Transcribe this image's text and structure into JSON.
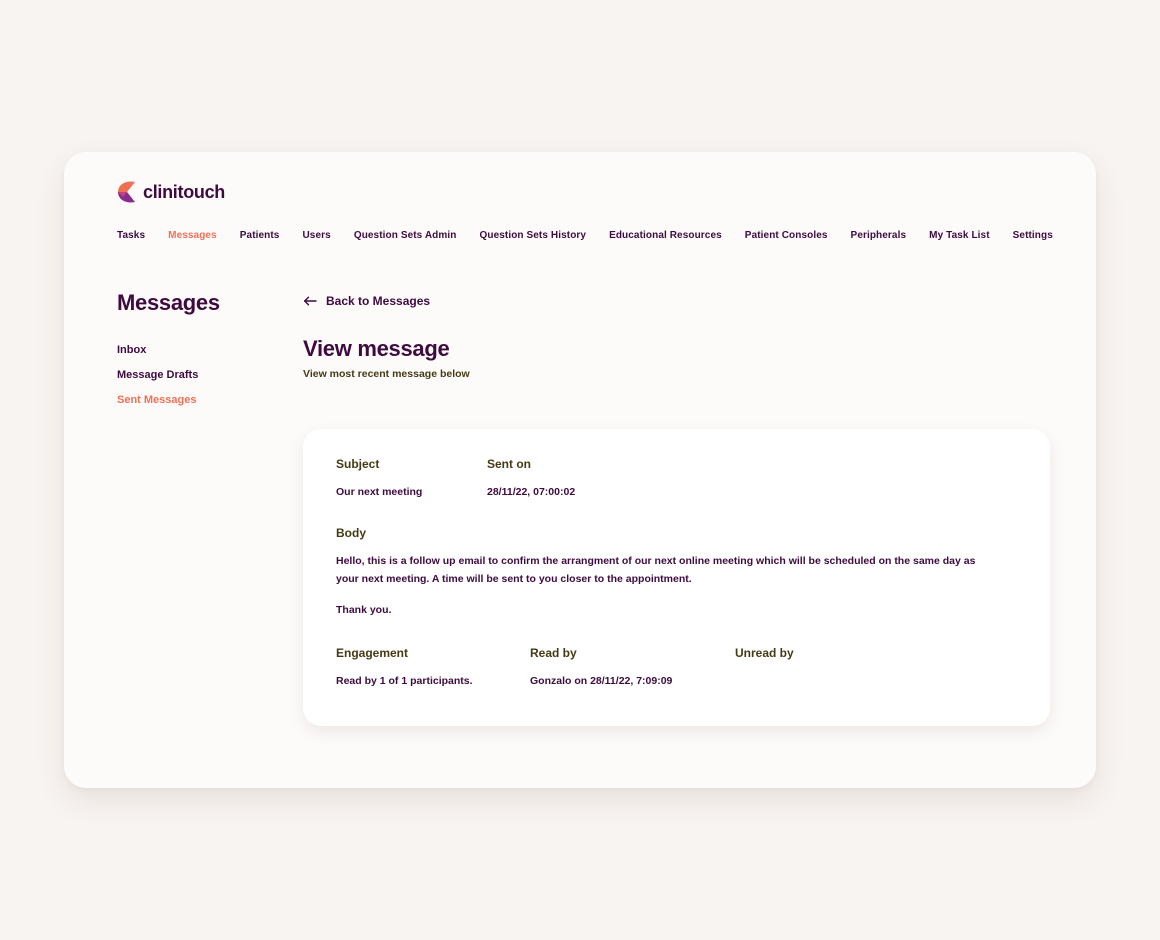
{
  "brand": {
    "name": "clinitouch"
  },
  "nav": [
    {
      "label": "Tasks",
      "active": false
    },
    {
      "label": "Messages",
      "active": true
    },
    {
      "label": "Patients",
      "active": false
    },
    {
      "label": "Users",
      "active": false
    },
    {
      "label": "Question Sets Admin",
      "active": false
    },
    {
      "label": "Question Sets History",
      "active": false
    },
    {
      "label": "Educational Resources",
      "active": false
    },
    {
      "label": "Patient Consoles",
      "active": false
    },
    {
      "label": "Peripherals",
      "active": false
    },
    {
      "label": "My Task List",
      "active": false
    },
    {
      "label": "Settings",
      "active": false
    }
  ],
  "sidebar": {
    "title": "Messages",
    "items": [
      {
        "label": "Inbox",
        "active": false
      },
      {
        "label": "Message Drafts",
        "active": false
      },
      {
        "label": "Sent Messages",
        "active": true
      }
    ]
  },
  "back": {
    "label": "Back to Messages",
    "icon": "arrow-left-icon"
  },
  "page": {
    "title": "View message",
    "subtitle": "View most recent message below"
  },
  "message": {
    "subject_label": "Subject",
    "subject": "Our next meeting",
    "sent_label": "Sent on",
    "sent": "28/11/22, 07:00:02",
    "body_label": "Body",
    "body": "Hello, this is a follow up email to confirm the arrangment of our next online meeting which will be scheduled on the same day as your next meeting. A time will be sent to you closer to the appointment.",
    "thanks": "Thank you.",
    "engagement_label": "Engagement",
    "engagement": "Read by 1 of 1 participants.",
    "read_by_label": "Read by",
    "read_by": "Gonzalo on 28/11/22, 7:09:09",
    "unread_by_label": "Unread by",
    "unread_by": ""
  },
  "colors": {
    "primary": "#3d0b3f",
    "accent": "#ef7155",
    "label": "#463a14",
    "background": "#f8f4f1"
  }
}
